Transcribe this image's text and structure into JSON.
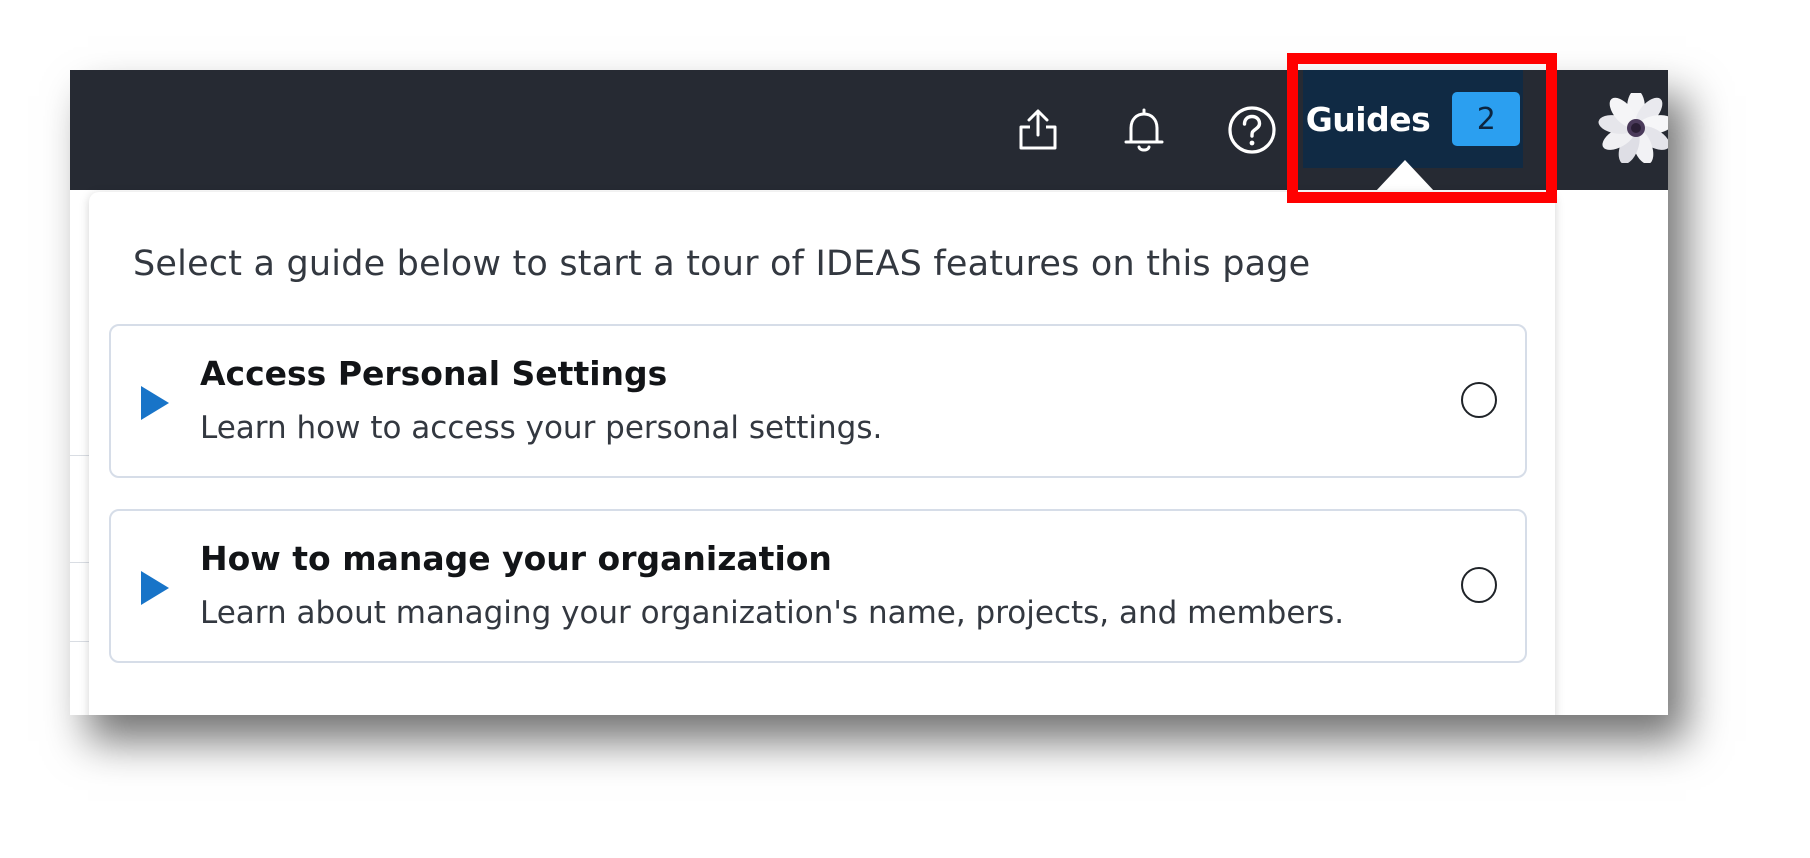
{
  "topbar": {
    "icons": [
      "share-upload-icon",
      "bell-icon",
      "help-icon"
    ],
    "guides_label": "Guides",
    "guides_count": "2",
    "avatar_icon": "daisy-flower-avatar"
  },
  "popover": {
    "title": "Select a guide below to start a tour of IDEAS features on this page",
    "guides": [
      {
        "title": "Access Personal Settings",
        "description": "Learn how to access your personal settings."
      },
      {
        "title": "How to manage your organization",
        "description": "Learn about managing your organization's name, projects, and members."
      }
    ]
  },
  "colors": {
    "topbar_bg": "#262a33",
    "guides_button_bg": "#102a44",
    "badge_bg": "#2b9ff0",
    "play_icon": "#1874c8",
    "card_border": "#d6dde8",
    "highlight": "#ff0000"
  }
}
